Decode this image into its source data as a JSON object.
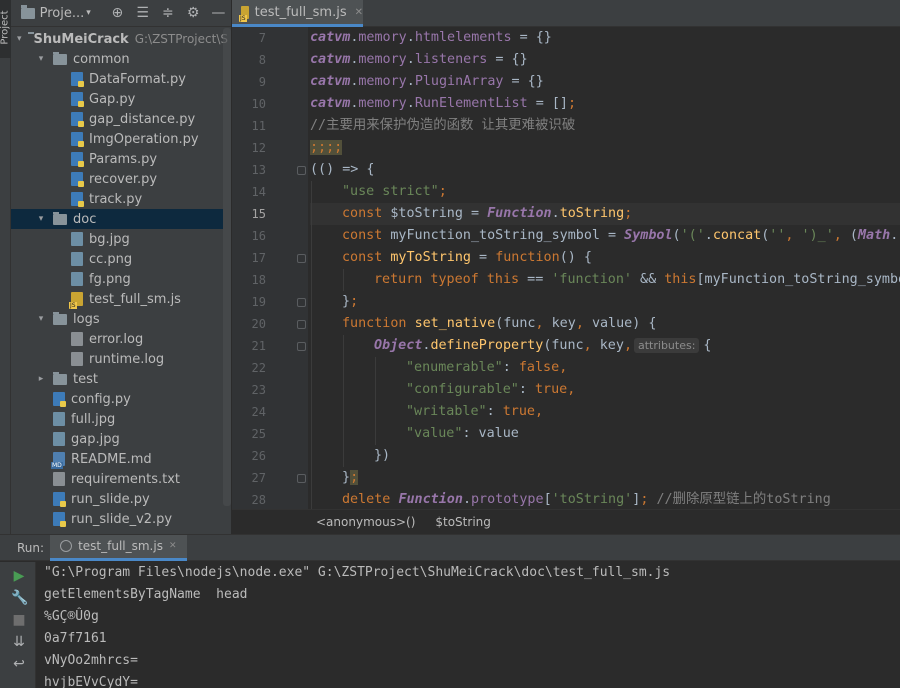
{
  "side_strip": {
    "project_vtab": "Project"
  },
  "project_panel": {
    "title": "Proje...",
    "tree": [
      {
        "label": "ShuMeiCrack",
        "path": "G:\\ZSTProject\\S",
        "type": "folder",
        "depth": 0,
        "expanded": true,
        "root": true
      },
      {
        "label": "common",
        "type": "folder",
        "depth": 1,
        "expanded": true
      },
      {
        "label": "DataFormat.py",
        "type": "py",
        "depth": 2
      },
      {
        "label": "Gap.py",
        "type": "py",
        "depth": 2
      },
      {
        "label": "gap_distance.py",
        "type": "py",
        "depth": 2
      },
      {
        "label": "ImgOperation.py",
        "type": "py",
        "depth": 2
      },
      {
        "label": "Params.py",
        "type": "py",
        "depth": 2
      },
      {
        "label": "recover.py",
        "type": "py",
        "depth": 2
      },
      {
        "label": "track.py",
        "type": "py",
        "depth": 2
      },
      {
        "label": "doc",
        "type": "folder",
        "depth": 1,
        "expanded": true,
        "selected": true
      },
      {
        "label": "bg.jpg",
        "type": "img",
        "depth": 2
      },
      {
        "label": "cc.png",
        "type": "img",
        "depth": 2
      },
      {
        "label": "fg.png",
        "type": "img",
        "depth": 2
      },
      {
        "label": "test_full_sm.js",
        "type": "js",
        "depth": 2
      },
      {
        "label": "logs",
        "type": "folder",
        "depth": 1,
        "expanded": true
      },
      {
        "label": "error.log",
        "type": "txt",
        "depth": 2
      },
      {
        "label": "runtime.log",
        "type": "txt",
        "depth": 2
      },
      {
        "label": "test",
        "type": "folder",
        "depth": 1,
        "expanded": false
      },
      {
        "label": "config.py",
        "type": "py",
        "depth": 1
      },
      {
        "label": "full.jpg",
        "type": "img",
        "depth": 1
      },
      {
        "label": "gap.jpg",
        "type": "img",
        "depth": 1
      },
      {
        "label": "README.md",
        "type": "md",
        "depth": 1
      },
      {
        "label": "requirements.txt",
        "type": "txt",
        "depth": 1
      },
      {
        "label": "run_slide.py",
        "type": "py",
        "depth": 1
      },
      {
        "label": "run_slide_v2.py",
        "type": "py",
        "depth": 1
      }
    ]
  },
  "editor": {
    "tab_label": "test_full_sm.js",
    "current_line": 15,
    "lines": [
      {
        "n": 7,
        "indent": 0,
        "fold": false,
        "segs": [
          {
            "t": "catvm",
            "c": "cls"
          },
          {
            "t": ".",
            "c": "ident"
          },
          {
            "t": "memory",
            "c": "fld"
          },
          {
            "t": ".",
            "c": "ident"
          },
          {
            "t": "htmlelements",
            "c": "fld"
          },
          {
            "t": " = {}",
            "c": "ident"
          }
        ]
      },
      {
        "n": 8,
        "indent": 0,
        "fold": false,
        "segs": [
          {
            "t": "catvm",
            "c": "cls"
          },
          {
            "t": ".",
            "c": "ident"
          },
          {
            "t": "memory",
            "c": "fld"
          },
          {
            "t": ".",
            "c": "ident"
          },
          {
            "t": "listeners",
            "c": "fld"
          },
          {
            "t": " = {}",
            "c": "ident"
          }
        ]
      },
      {
        "n": 9,
        "indent": 0,
        "fold": false,
        "segs": [
          {
            "t": "catvm",
            "c": "cls"
          },
          {
            "t": ".",
            "c": "ident"
          },
          {
            "t": "memory",
            "c": "fld"
          },
          {
            "t": ".",
            "c": "ident"
          },
          {
            "t": "PluginArray",
            "c": "fld"
          },
          {
            "t": " = {}",
            "c": "ident"
          }
        ]
      },
      {
        "n": 10,
        "indent": 0,
        "fold": false,
        "segs": [
          {
            "t": "catvm",
            "c": "cls"
          },
          {
            "t": ".",
            "c": "ident"
          },
          {
            "t": "memory",
            "c": "fld"
          },
          {
            "t": ".",
            "c": "ident"
          },
          {
            "t": "RunElementList",
            "c": "fld"
          },
          {
            "t": " = []",
            "c": "ident"
          },
          {
            "t": ";",
            "c": "kw"
          }
        ]
      },
      {
        "n": 11,
        "indent": 0,
        "fold": false,
        "segs": [
          {
            "t": "//主要用来保护伪造的函数 让其更难被识破",
            "c": "cmt"
          }
        ]
      },
      {
        "n": 12,
        "indent": 0,
        "fold": false,
        "segs": [
          {
            "t": ";;;;",
            "c": "hl-yellow"
          }
        ]
      },
      {
        "n": 13,
        "indent": 0,
        "fold": true,
        "segs": [
          {
            "t": "(() => {",
            "c": "ident"
          }
        ]
      },
      {
        "n": 14,
        "indent": 1,
        "fold": false,
        "segs": [
          {
            "t": "\"use strict\"",
            "c": "str"
          },
          {
            "t": ";",
            "c": "kw"
          }
        ]
      },
      {
        "n": 15,
        "indent": 1,
        "fold": false,
        "segs": [
          {
            "t": "const ",
            "c": "kw"
          },
          {
            "t": "$toString = ",
            "c": "ident"
          },
          {
            "t": "Function",
            "c": "cls"
          },
          {
            "t": ".",
            "c": "ident"
          },
          {
            "t": "toString",
            "c": "fn"
          },
          {
            "t": ";",
            "c": "kw"
          }
        ]
      },
      {
        "n": 16,
        "indent": 1,
        "fold": false,
        "segs": [
          {
            "t": "const ",
            "c": "kw"
          },
          {
            "t": "myFunction_toString_symbol = ",
            "c": "ident"
          },
          {
            "t": "Symbol",
            "c": "cls"
          },
          {
            "t": "(",
            "c": "ident"
          },
          {
            "t": "'('",
            "c": "str"
          },
          {
            "t": ".",
            "c": "ident"
          },
          {
            "t": "concat",
            "c": "fn"
          },
          {
            "t": "(",
            "c": "ident"
          },
          {
            "t": "''",
            "c": "str"
          },
          {
            "t": ", ",
            "c": "kw"
          },
          {
            "t": "')_'",
            "c": "str"
          },
          {
            "t": ", ",
            "c": "kw"
          },
          {
            "t": "(",
            "c": "ident"
          },
          {
            "t": "Math",
            "c": "cls"
          },
          {
            "t": ".r",
            "c": "ident"
          }
        ]
      },
      {
        "n": 17,
        "indent": 1,
        "fold": true,
        "segs": [
          {
            "t": "const ",
            "c": "kw"
          },
          {
            "t": "myToString",
            "c": "fn"
          },
          {
            "t": " = ",
            "c": "ident"
          },
          {
            "t": "function",
            "c": "kw"
          },
          {
            "t": "() {",
            "c": "ident"
          }
        ]
      },
      {
        "n": 18,
        "indent": 2,
        "fold": false,
        "segs": [
          {
            "t": "return typeof this",
            "c": "kw"
          },
          {
            "t": " == ",
            "c": "ident"
          },
          {
            "t": "'function'",
            "c": "str"
          },
          {
            "t": " && ",
            "c": "ident"
          },
          {
            "t": "this",
            "c": "kw"
          },
          {
            "t": "[myFunction_toString_symbo",
            "c": "ident"
          }
        ]
      },
      {
        "n": 19,
        "indent": 1,
        "fold": true,
        "segs": [
          {
            "t": "}",
            "c": "ident"
          },
          {
            "t": ";",
            "c": "kw"
          }
        ]
      },
      {
        "n": 20,
        "indent": 1,
        "fold": true,
        "segs": [
          {
            "t": "function ",
            "c": "kw"
          },
          {
            "t": "set_native",
            "c": "fn"
          },
          {
            "t": "(func",
            "c": "ident"
          },
          {
            "t": ", ",
            "c": "kw"
          },
          {
            "t": "key",
            "c": "ident"
          },
          {
            "t": ", ",
            "c": "kw"
          },
          {
            "t": "value) {",
            "c": "ident"
          }
        ]
      },
      {
        "n": 21,
        "indent": 2,
        "fold": true,
        "segs": [
          {
            "t": "Object",
            "c": "cls"
          },
          {
            "t": ".",
            "c": "ident"
          },
          {
            "t": "defineProperty",
            "c": "fn"
          },
          {
            "t": "(func",
            "c": "ident"
          },
          {
            "t": ", ",
            "c": "kw"
          },
          {
            "t": "key",
            "c": "ident"
          },
          {
            "t": ",",
            "c": "kw"
          },
          {
            "t": "attributes:",
            "c": "hint"
          },
          {
            "t": "{",
            "c": "ident"
          }
        ]
      },
      {
        "n": 22,
        "indent": 3,
        "fold": false,
        "segs": [
          {
            "t": "\"enumerable\"",
            "c": "str"
          },
          {
            "t": ": ",
            "c": "ident"
          },
          {
            "t": "false",
            "c": "kw"
          },
          {
            "t": ",",
            "c": "kw"
          }
        ]
      },
      {
        "n": 23,
        "indent": 3,
        "fold": false,
        "segs": [
          {
            "t": "\"configurable\"",
            "c": "str"
          },
          {
            "t": ": ",
            "c": "ident"
          },
          {
            "t": "true",
            "c": "kw"
          },
          {
            "t": ",",
            "c": "kw"
          }
        ]
      },
      {
        "n": 24,
        "indent": 3,
        "fold": false,
        "segs": [
          {
            "t": "\"writable\"",
            "c": "str"
          },
          {
            "t": ": ",
            "c": "ident"
          },
          {
            "t": "true",
            "c": "kw"
          },
          {
            "t": ",",
            "c": "kw"
          }
        ]
      },
      {
        "n": 25,
        "indent": 3,
        "fold": false,
        "segs": [
          {
            "t": "\"value\"",
            "c": "str"
          },
          {
            "t": ": value",
            "c": "ident"
          }
        ]
      },
      {
        "n": 26,
        "indent": 2,
        "fold": false,
        "segs": [
          {
            "t": "})",
            "c": "ident"
          }
        ]
      },
      {
        "n": 27,
        "indent": 1,
        "fold": true,
        "segs": [
          {
            "t": "}",
            "c": "ident"
          },
          {
            "t": ";",
            "c": "hl-yellow"
          }
        ]
      },
      {
        "n": 28,
        "indent": 1,
        "fold": false,
        "segs": [
          {
            "t": "delete ",
            "c": "kw"
          },
          {
            "t": "Function",
            "c": "cls"
          },
          {
            "t": ".",
            "c": "ident"
          },
          {
            "t": "prototype",
            "c": "fld"
          },
          {
            "t": "[",
            "c": "ident"
          },
          {
            "t": "'toString'",
            "c": "str"
          },
          {
            "t": "]",
            "c": "ident"
          },
          {
            "t": "; ",
            "c": "kw"
          },
          {
            "t": "//删除原型链上的toString",
            "c": "cmt"
          }
        ]
      }
    ],
    "breadcrumbs": [
      "<anonymous>()",
      "$toString"
    ]
  },
  "run": {
    "label": "Run:",
    "tab_label": "test_full_sm.js",
    "output": [
      "\"G:\\Program Files\\nodejs\\node.exe\" G:\\ZSTProject\\ShuMeiCrack\\doc\\test_full_sm.js",
      "getElementsByTagName  head",
      "%GÇ®Û0g",
      "0a7f7161",
      "vNyOo2mhrcs=",
      "hvjbEVvCydY="
    ]
  },
  "colors": {
    "background": "#2b2b2b",
    "panel": "#3c3f41",
    "selection": "#0d293e",
    "accent": "#4a88c7",
    "keyword": "#cc7832",
    "string": "#6a8759",
    "field": "#9876aa",
    "function": "#ffc66d",
    "comment": "#808080",
    "run_green": "#499c54"
  }
}
